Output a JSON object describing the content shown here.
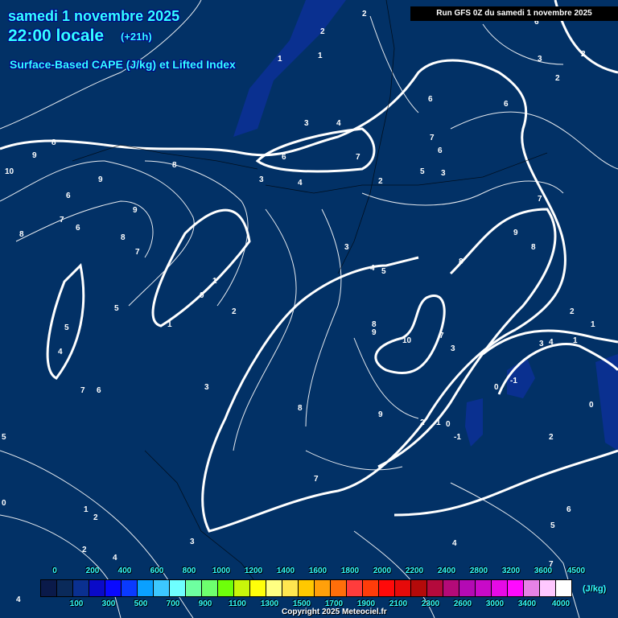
{
  "header": {
    "date": "samedi 1 novembre 2025",
    "time": "22:00 locale",
    "lead": "(+21h)",
    "product": "Surface-Based CAPE (J/kg) et Lifted Index"
  },
  "run_banner": "Run GFS 0Z du samedi 1 novembre 2025",
  "legend": {
    "unit": "(J/kg)",
    "colors": [
      "#0a1a4a",
      "#0a2a5a",
      "#0a3090",
      "#0a0ac8",
      "#0a0aff",
      "#0a3aff",
      "#0aa0ff",
      "#3cc8ff",
      "#6effff",
      "#6effa0",
      "#6eff6e",
      "#6eff0a",
      "#c8f50a",
      "#ffff0a",
      "#ffff82",
      "#ffe650",
      "#ffc800",
      "#ffa00a",
      "#ff6e0a",
      "#ff3c3c",
      "#ff3c0a",
      "#ff0a0a",
      "#e60a0a",
      "#b40a0a",
      "#b40a3c",
      "#b40a78",
      "#b40ab4",
      "#c80ac8",
      "#e60ae6",
      "#ff0aff",
      "#e682e6",
      "#ffc8ff",
      "#ffffff"
    ],
    "top_labels": [
      "0",
      "200",
      "400",
      "600",
      "800",
      "1000",
      "1200",
      "1400",
      "1600",
      "1800",
      "2000",
      "2200",
      "2400",
      "2800",
      "3200",
      "3600",
      "4500"
    ],
    "bottom_labels": [
      "100",
      "300",
      "500",
      "700",
      "900",
      "1100",
      "1300",
      "1500",
      "1700",
      "1900",
      "2100",
      "2300",
      "2600",
      "3000",
      "3400",
      "4000"
    ]
  },
  "copyright": "Copyright 2025 Meteociel.fr",
  "colors": {
    "background": "#023166",
    "low_li": "#0a3090"
  }
}
